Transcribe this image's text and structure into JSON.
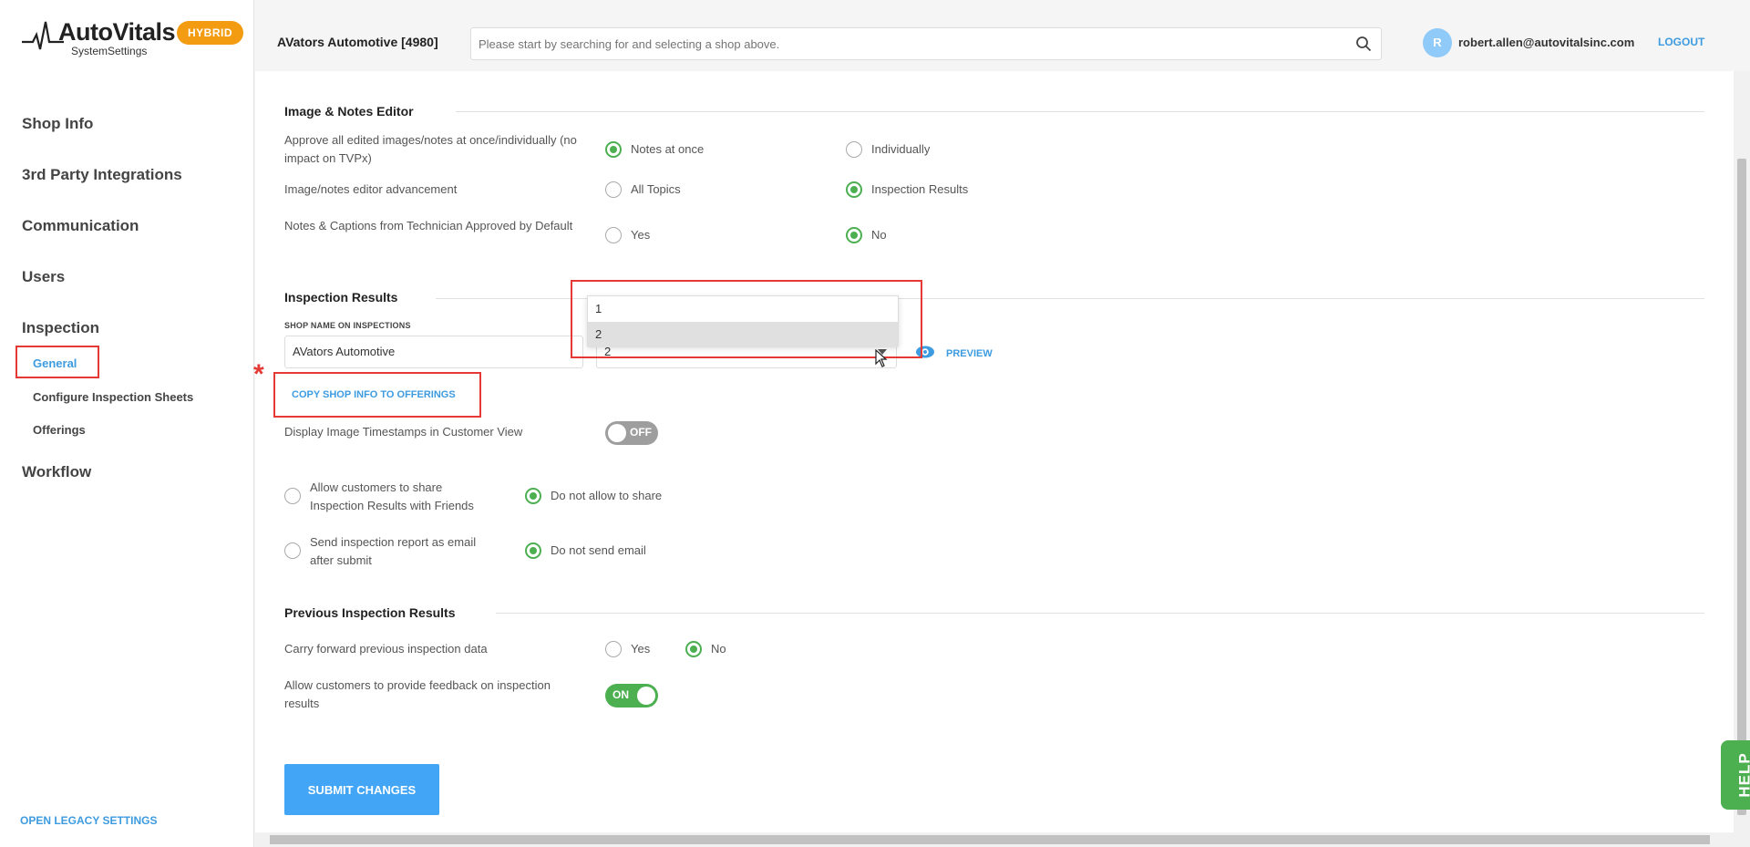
{
  "brand": {
    "name": "AutoVitals",
    "sub": "SystemSettings",
    "badge": "HYBRID"
  },
  "sidebar": {
    "items": [
      {
        "label": "Shop Info"
      },
      {
        "label": "3rd Party Integrations"
      },
      {
        "label": "Communication"
      },
      {
        "label": "Users"
      },
      {
        "label": "Inspection"
      },
      {
        "label": "Workflow"
      }
    ],
    "sub_items": [
      {
        "label": "General"
      },
      {
        "label": "Configure Inspection Sheets"
      },
      {
        "label": "Offerings"
      }
    ],
    "legacy_link": "OPEN LEGACY SETTINGS"
  },
  "header": {
    "shop_title": "AVators Automotive [4980]",
    "search_placeholder": "Please start by searching for and selecting a shop above.",
    "avatar_initial": "R",
    "user_email": "robert.allen@autovitalsinc.com",
    "logout": "LOGOUT"
  },
  "image_notes": {
    "title": "Image & Notes Editor",
    "rows": [
      {
        "label": "Approve all edited images/notes at once/individually (no impact on TVPx)",
        "opt1": "Notes at once",
        "opt2": "Individually",
        "selected": 1
      },
      {
        "label": "Image/notes editor advancement",
        "opt1": "All Topics",
        "opt2": "Inspection Results",
        "selected": 2
      },
      {
        "label": "Notes & Captions from Technician Approved by Default",
        "opt1": "Yes",
        "opt2": "No",
        "selected": 2
      }
    ]
  },
  "inspection_results": {
    "title": "Inspection Results",
    "shop_name_label": "SHOP NAME ON INSPECTIONS",
    "shop_name_value": "AVators Automotive",
    "select_value": "2",
    "dropdown_options": [
      "1",
      "2"
    ],
    "preview": "PREVIEW",
    "copy_link": "COPY SHOP INFO TO OFFERINGS",
    "timestamps_label": "Display Image Timestamps in Customer View",
    "timestamps_toggle": "OFF",
    "share_opt1": "Allow customers to share Inspection Results with Friends",
    "share_opt2": "Do not allow to share",
    "email_opt1": "Send inspection report as email after submit",
    "email_opt2": "Do not send email"
  },
  "previous_results": {
    "title": "Previous Inspection Results",
    "carry_label": "Carry forward previous inspection data",
    "carry_opt1": "Yes",
    "carry_opt2": "No",
    "feedback_label": "Allow customers to provide feedback on inspection results",
    "feedback_toggle": "ON"
  },
  "submit": "SUBMIT CHANGES",
  "help": "HELP",
  "colors": {
    "accent": "#3d9be0",
    "success": "#4caf50",
    "badge": "#f39c12",
    "highlight": "#e53935"
  }
}
